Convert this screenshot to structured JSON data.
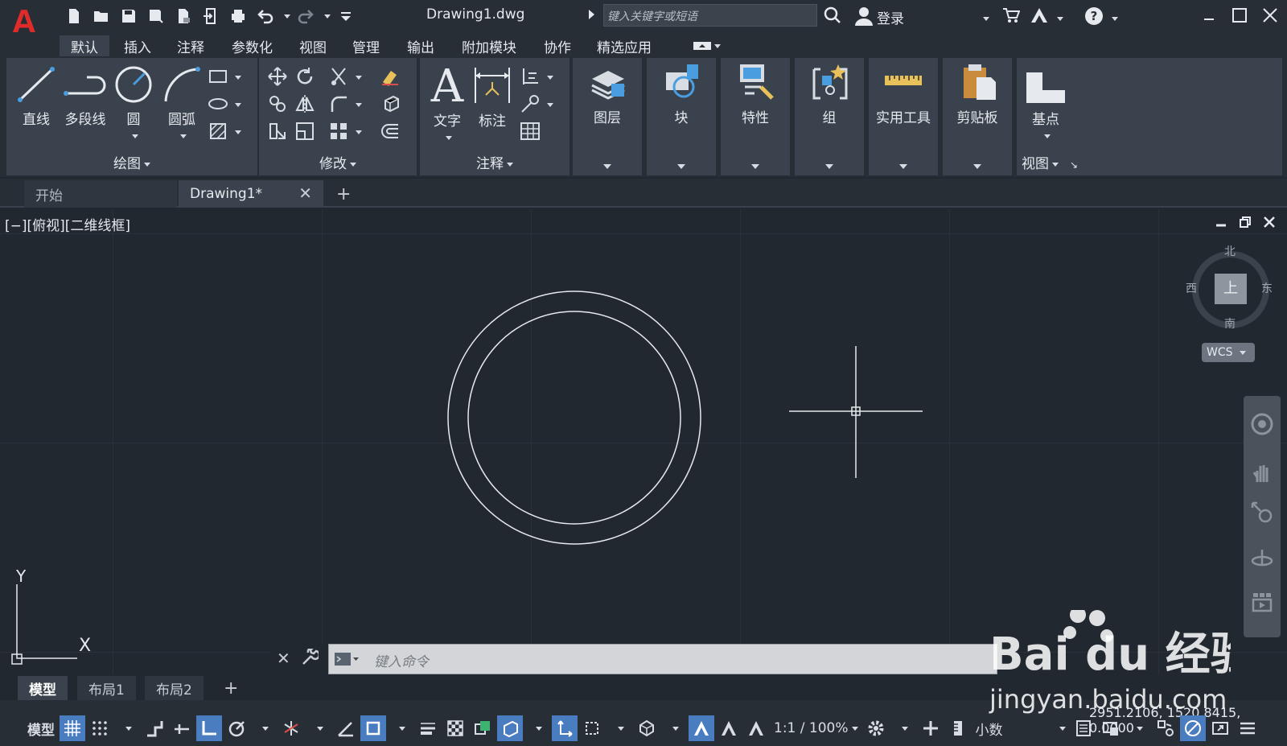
{
  "title_bar": {
    "app_logo": "A",
    "document_title": "Drawing1.dwg",
    "search_placeholder": "键入关键字或短语",
    "login_label": "登录"
  },
  "menu_tabs": [
    "默认",
    "插入",
    "注释",
    "参数化",
    "视图",
    "管理",
    "输出",
    "附加模块",
    "协作",
    "精选应用"
  ],
  "ribbon": {
    "draw_panel": {
      "title": "绘图",
      "buttons": [
        "直线",
        "多段线",
        "圆",
        "圆弧"
      ]
    },
    "modify_panel": {
      "title": "修改"
    },
    "annotation_panel": {
      "title": "注释",
      "buttons": [
        "文字",
        "标注"
      ]
    },
    "single_panels": [
      "图层",
      "块",
      "特性",
      "组",
      "实用工具",
      "剪贴板"
    ],
    "view_panel": {
      "title": "视图",
      "button": "基点"
    }
  },
  "file_tabs": {
    "start": "开始",
    "document": "Drawing1*",
    "add": "+"
  },
  "viewport": {
    "label": "[−][俯视][二维线框]",
    "compass": {
      "north": "北",
      "south": "南",
      "east": "东",
      "west": "西",
      "top": "上"
    },
    "wcs": "WCS",
    "ucs_x": "X",
    "ucs_y": "Y"
  },
  "command_line": {
    "placeholder": "键入命令"
  },
  "layout_tabs": [
    "模型",
    "布局1",
    "布局2",
    "+"
  ],
  "status_bar": {
    "coordinates": "2951.2106, 1520.8415, 0.0000",
    "model_label": "模型",
    "scale": "1:1 / 100%",
    "units": "小数"
  },
  "watermark": {
    "brand": "Bai du 经验",
    "url": "jingyan.baidu.com"
  },
  "colors": {
    "canvas": "#212830",
    "panel": "#3a434d",
    "accent": "#4a7dbf",
    "logo_red": "#e02b2b"
  }
}
